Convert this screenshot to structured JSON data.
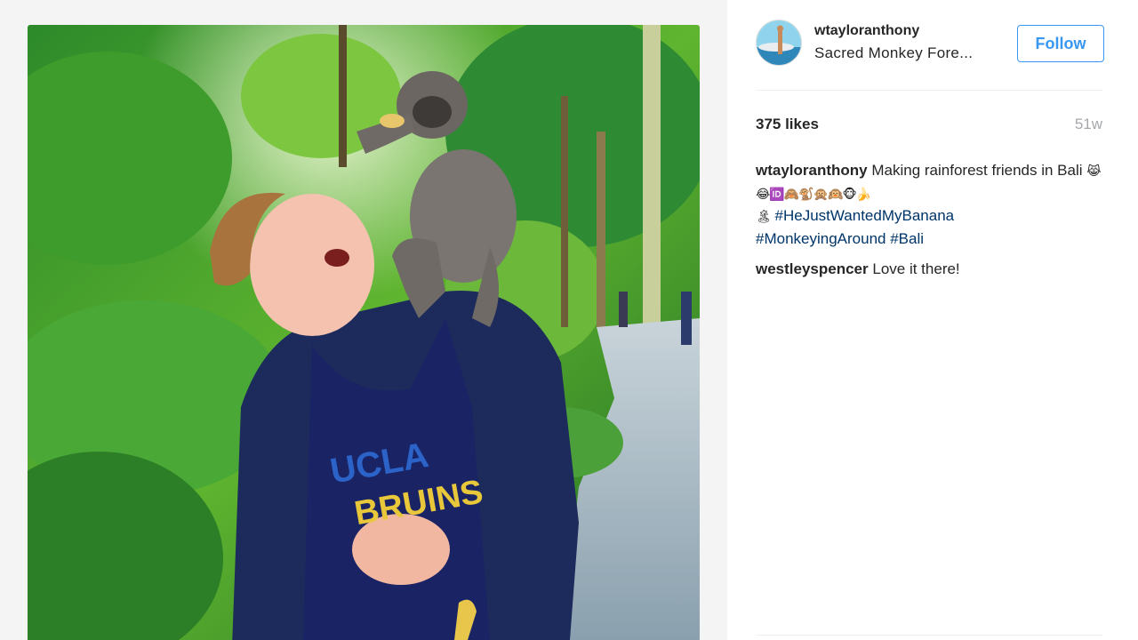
{
  "post": {
    "username": "wtayloranthony",
    "location": "Sacred Monkey Fore...",
    "follow_label": "Follow",
    "likes": "375 likes",
    "time_ago": "51w",
    "caption": {
      "username": "wtayloranthony",
      "text": "Making rainforest friends in Bali",
      "emojis": "😹😂🆔🙈🐒🙊🙉🐵🍌",
      "emojis_line2": "🏝",
      "hashtags": [
        "#HeJustWantedMyBanana",
        "#MonkeyingAround",
        "#Bali"
      ]
    },
    "comments": [
      {
        "username": "westleyspencer",
        "text": "Love it there!"
      }
    ],
    "photo": {
      "shirt_text_line1": "UCLA",
      "shirt_text_line2": "BRUINS"
    }
  },
  "colors": {
    "follow_blue": "#3897f0",
    "hashtag": "#003569",
    "time_gray": "#a5a7aa"
  }
}
